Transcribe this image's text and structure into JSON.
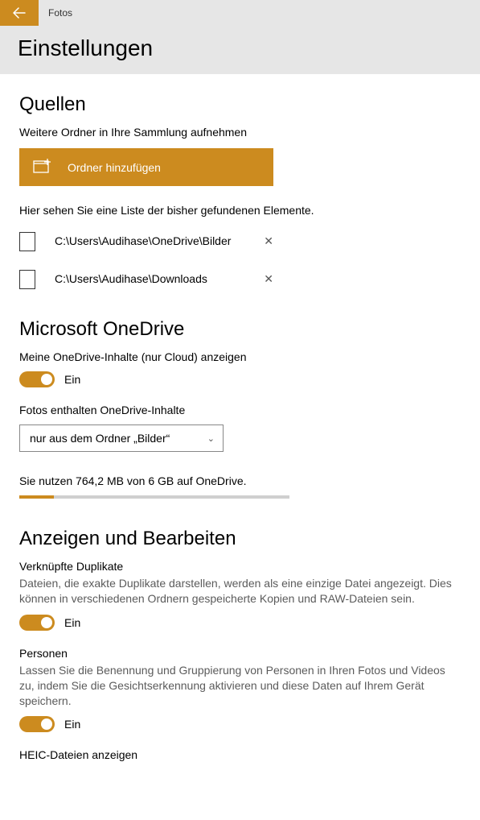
{
  "header": {
    "app_title": "Fotos",
    "page_title": "Einstellungen"
  },
  "sources": {
    "heading": "Quellen",
    "add_desc": "Weitere Ordner in Ihre Sammlung aufnehmen",
    "add_button": "Ordner hinzufügen",
    "list_desc": "Hier sehen Sie eine Liste der bisher gefundenen Elemente.",
    "folders": [
      {
        "path": "C:\\Users\\Audihase\\OneDrive\\Bilder"
      },
      {
        "path": "C:\\Users\\Audihase\\Downloads"
      }
    ]
  },
  "onedrive": {
    "heading": "Microsoft OneDrive",
    "show_cloud_label": "Meine OneDrive-Inhalte (nur Cloud) anzeigen",
    "toggle_state": "Ein",
    "include_label": "Fotos enthalten OneDrive-Inhalte",
    "dropdown_value": "nur aus dem Ordner „Bilder“",
    "usage_text": "Sie nutzen 764,2 MB von 6 GB auf OneDrive.",
    "usage_pct": 12.7
  },
  "display_edit": {
    "heading": "Anzeigen und Bearbeiten",
    "linked_dup_title": "Verknüpfte Duplikate",
    "linked_dup_desc": "Dateien, die exakte Duplikate darstellen, werden als eine einzige Datei angezeigt. Dies können in verschiedenen Ordnern gespeicherte Kopien und RAW-Dateien sein.",
    "linked_dup_state": "Ein",
    "people_title": "Personen",
    "people_desc": "Lassen Sie die Benennung und Gruppierung von Personen in Ihren Fotos und Videos zu, indem Sie die Gesichtserkennung aktivieren und diese Daten auf Ihrem Gerät speichern.",
    "people_state": "Ein",
    "heic_title": "HEIC-Dateien anzeigen"
  }
}
